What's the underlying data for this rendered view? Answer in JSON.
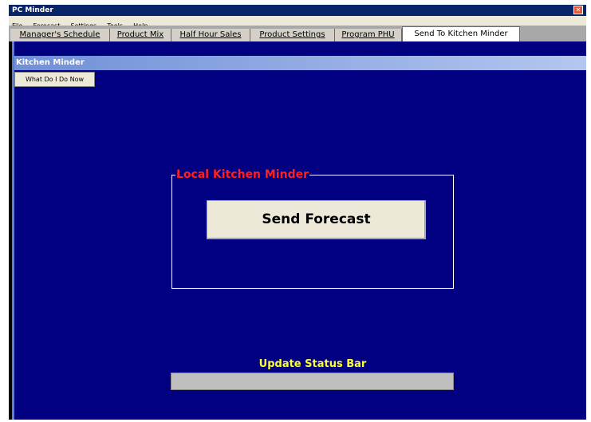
{
  "window": {
    "title": "PC Minder"
  },
  "menu": [
    "File",
    "Forecast",
    "Settings",
    "Tools",
    "Help"
  ],
  "tabs": [
    "Manager's Schedule",
    "Product Mix",
    "Half Hour Sales",
    "Product Settings",
    "Program PHU",
    "Send To Kitchen Minder"
  ],
  "active_tab": "Send To Kitchen Minder",
  "panel": {
    "title": "Kitchen Minder",
    "help_button": "What Do I Do Now",
    "group_label": "Local Kitchen Minder",
    "send_button": "Send Forecast",
    "status_label": "Update Status Bar",
    "status_progress": 0
  },
  "colors": {
    "panel_background": "#000080",
    "group_label": "#ff2020",
    "status_label": "#ffff33",
    "status_bar": "#bfbfbf"
  },
  "icons": {
    "close": "close-icon"
  }
}
